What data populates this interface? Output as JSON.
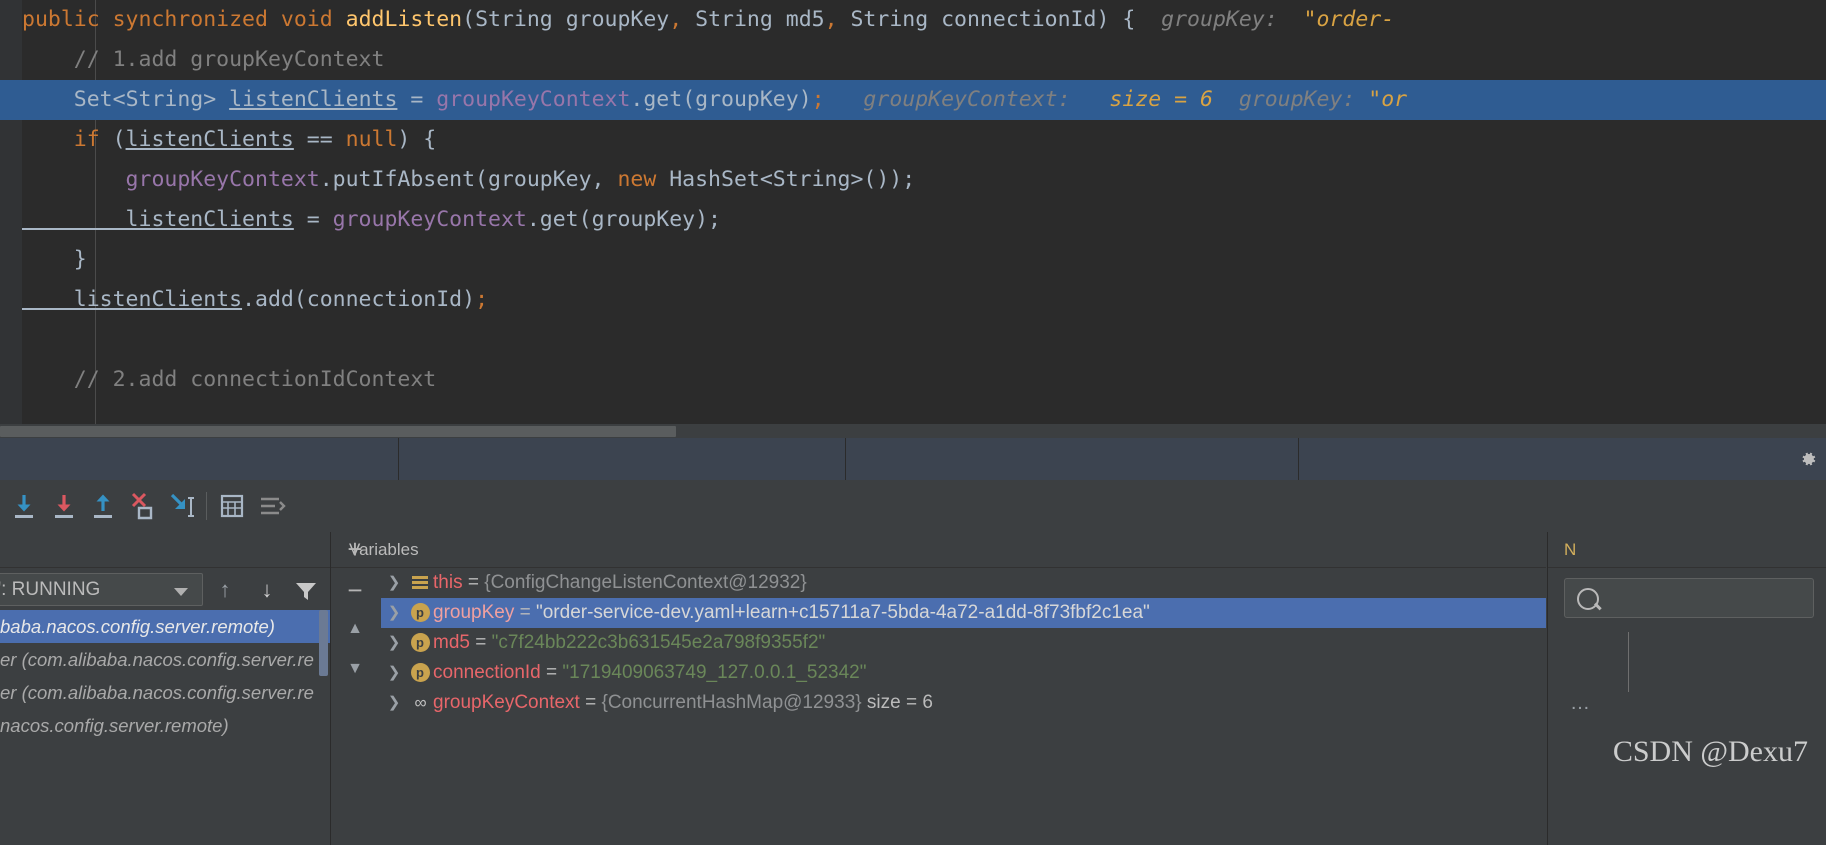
{
  "editor": {
    "lines": [
      {
        "id": "l1",
        "highlighted": false,
        "tokens": [
          {
            "t": "public ",
            "c": "kw"
          },
          {
            "t": "synchronized ",
            "c": "kw"
          },
          {
            "t": "void ",
            "c": "kw"
          },
          {
            "t": "addListen",
            "c": "fn"
          },
          {
            "t": "(",
            "c": "pln"
          },
          {
            "t": "String",
            "c": "typ"
          },
          {
            "t": " groupKey",
            "c": "pln"
          },
          {
            "t": ",",
            "c": "kw"
          },
          {
            "t": " String",
            "c": "typ"
          },
          {
            "t": " md5",
            "c": "pln"
          },
          {
            "t": ",",
            "c": "kw"
          },
          {
            "t": " String",
            "c": "typ"
          },
          {
            "t": " connectionId",
            "c": "pln"
          },
          {
            "t": ") {",
            "c": "pln"
          },
          {
            "t": "  groupKey:",
            "c": "hint"
          },
          {
            "t": "  \"order-",
            "c": "hintn"
          }
        ]
      },
      {
        "id": "l2",
        "highlighted": false,
        "tokens": [
          {
            "t": "    // 1.add groupKeyContext",
            "c": "cmt"
          }
        ]
      },
      {
        "id": "l3",
        "highlighted": true,
        "tokens": [
          {
            "t": "    Set",
            "c": "typ"
          },
          {
            "t": "<",
            "c": "pln"
          },
          {
            "t": "String",
            "c": "typ"
          },
          {
            "t": "> ",
            "c": "pln"
          },
          {
            "t": "listenClients",
            "c": "loc"
          },
          {
            "t": " = ",
            "c": "pln"
          },
          {
            "t": "groupKeyContext",
            "c": "fld"
          },
          {
            "t": ".get(groupKey)",
            "c": "pln"
          },
          {
            "t": ";",
            "c": "kw"
          },
          {
            "t": "   groupKeyContext:",
            "c": "hint"
          },
          {
            "t": "   size = 6",
            "c": "hintn"
          },
          {
            "t": "  groupKey:",
            "c": "hint"
          },
          {
            "t": " \"or",
            "c": "hintn"
          }
        ]
      },
      {
        "id": "l4",
        "highlighted": false,
        "tokens": [
          {
            "t": "    if ",
            "c": "kw"
          },
          {
            "t": "(",
            "c": "pln"
          },
          {
            "t": "listenClients",
            "c": "loc"
          },
          {
            "t": " == ",
            "c": "pln"
          },
          {
            "t": "null",
            "c": "kw"
          },
          {
            "t": ") {",
            "c": "pln"
          }
        ]
      },
      {
        "id": "l5",
        "highlighted": false,
        "tokens": [
          {
            "t": "        groupKeyContext",
            "c": "fld"
          },
          {
            "t": ".putIfAbsent(groupKey, ",
            "c": "pln"
          },
          {
            "t": "new ",
            "c": "kw"
          },
          {
            "t": "HashSet",
            "c": "pln"
          },
          {
            "t": "<",
            "c": "pln"
          },
          {
            "t": "String",
            "c": "typ"
          },
          {
            "t": ">());",
            "c": "pln"
          }
        ]
      },
      {
        "id": "l6",
        "highlighted": false,
        "tokens": [
          {
            "t": "        listenClients",
            "c": "loc"
          },
          {
            "t": " = ",
            "c": "pln"
          },
          {
            "t": "groupKeyContext",
            "c": "fld"
          },
          {
            "t": ".get(groupKey);",
            "c": "pln"
          }
        ]
      },
      {
        "id": "l7",
        "highlighted": false,
        "tokens": [
          {
            "t": "    }",
            "c": "pln"
          }
        ]
      },
      {
        "id": "l8",
        "highlighted": false,
        "tokens": [
          {
            "t": "    listenClients",
            "c": "loc"
          },
          {
            "t": ".add(connectionId)",
            "c": "pln"
          },
          {
            "t": ";",
            "c": "kw"
          }
        ]
      },
      {
        "id": "l9",
        "highlighted": false,
        "tokens": []
      },
      {
        "id": "l10",
        "highlighted": false,
        "tokens": [
          {
            "t": "    // 2.add connectionIdContext",
            "c": "cmt"
          }
        ]
      }
    ]
  },
  "debug_toolbar": {
    "buttons": [
      {
        "name": "step-over-icon",
        "title": "Step Over"
      },
      {
        "name": "step-into-icon",
        "title": "Step Into"
      },
      {
        "name": "step-out-icon",
        "title": "Step Out"
      },
      {
        "name": "force-step-into-icon",
        "title": "Force Step Into"
      },
      {
        "name": "run-to-cursor-icon",
        "title": "Run to Cursor"
      },
      {
        "name": "evaluate-expression-icon",
        "title": "Evaluate Expression"
      },
      {
        "name": "show-execution-point-icon",
        "title": "Show Execution Point"
      }
    ]
  },
  "frames": {
    "header": "",
    "thread_selector": "ain\": RUNNING",
    "rows": [
      {
        "text": "baba.nacos.config.server.remote)",
        "selected": true
      },
      {
        "text": "er (com.alibaba.nacos.config.server.re",
        "selected": false
      },
      {
        "text": "er (com.alibaba.nacos.config.server.re",
        "selected": false
      },
      {
        "text": "nacos.config.server.remote)",
        "selected": false
      }
    ]
  },
  "variables": {
    "header": "Variables",
    "rows": [
      {
        "icon": "object-icon",
        "name": "this",
        "eq": " = ",
        "ref": "{ConfigChangeListenContext@12932}",
        "str": "",
        "size": "",
        "selected": false
      },
      {
        "icon": "parameter-icon",
        "name": "groupKey",
        "eq": " = ",
        "ref": "",
        "str": "\"order-service-dev.yaml+learn+c15711a7-5bda-4a72-a1dd-8f73fbf2c1ea\"",
        "size": "",
        "selected": true
      },
      {
        "icon": "parameter-icon",
        "name": "md5",
        "eq": " = ",
        "ref": "",
        "str": "\"c7f24bb222c3b631545e2a798f9355f2\"",
        "size": "",
        "selected": false
      },
      {
        "icon": "parameter-icon",
        "name": "connectionId",
        "eq": " = ",
        "ref": "",
        "str": "\"1719409063749_127.0.0.1_52342\"",
        "size": "",
        "selected": false
      },
      {
        "icon": "map-icon",
        "name": "groupKeyContext",
        "eq": " = ",
        "ref": "{ConcurrentHashMap@12933}",
        "str": "",
        "size": "size = 6",
        "selected": false
      }
    ],
    "add_label": "+",
    "remove_label": "−"
  },
  "watches": {
    "header": "N",
    "search_placeholder": ""
  },
  "watermark": "CSDN @Dexu7",
  "colors": {
    "editor_bg": "#2b2b2b",
    "panel_bg": "#3c3f41",
    "selection_blue": "#4b6eaf",
    "line_highlight": "#2f5c92",
    "tab_bg": "#3c4450",
    "keyword_orange": "#cc7832",
    "string_green": "#6a8759",
    "field_purple": "#9876aa",
    "method_yellow": "#ffc66d",
    "comment_gray": "#808080",
    "text_gray": "#a9b7c6",
    "var_red": "#e8666a",
    "icon_gold": "#c9a34e",
    "step_blue": "#3592c4",
    "step_red": "#db5860"
  }
}
